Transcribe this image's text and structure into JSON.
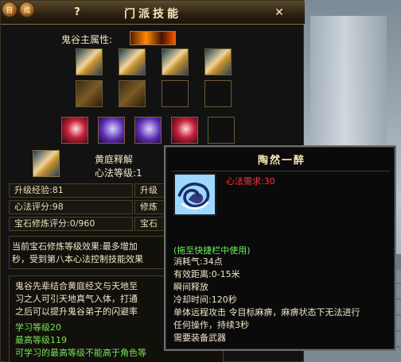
{
  "window": {
    "title": "门派技能",
    "help_label": "?",
    "close_label": "✕",
    "top_left_buttons": [
      "目",
      "成"
    ]
  },
  "attribute": {
    "label": "鬼谷主属性:",
    "icon": "fire-icon"
  },
  "selected_skill": {
    "name": "黄庭释解",
    "level_label": "心法等级:1"
  },
  "stats_left": [
    "升级经验:81",
    "心法评分:98",
    "宝石修炼评分:0/960"
  ],
  "stats_right_partial": [
    "升级",
    "修炼",
    "宝石"
  ],
  "gem_effect": {
    "line1": "当前宝石修炼等级效果:最多增加",
    "line2": "秒，受到第八本心法控制技能效果"
  },
  "description": {
    "line1": "鬼谷先辈结合黄庭经文与天地至",
    "line2": "习之人可引天地真气入体，打通",
    "line3": "之后可以提升鬼谷弟子的闪避率",
    "learn_level": "学习等级20",
    "max_level": "最高等级119",
    "max_level_note": "可学习的最高等级不能高于角色等"
  },
  "tooltip": {
    "title": "陶然一醉",
    "requirement": "心法需求:30",
    "hint": "(拖至快捷栏中使用)",
    "lines": [
      "消耗气:34点",
      "有效距离:0-15米",
      "瞬间释放",
      "冷却时间:120秒",
      "单体远程攻击 令目标麻痹，麻痹状态下无法进行",
      "任何操作，持续3秒",
      "需要装备武器"
    ]
  },
  "colors": {
    "accent_gold": "#f7e8b8",
    "requirement_red": "#ff3a3a",
    "hint_green": "#6ff05d",
    "desc_green": "#78e15a"
  }
}
